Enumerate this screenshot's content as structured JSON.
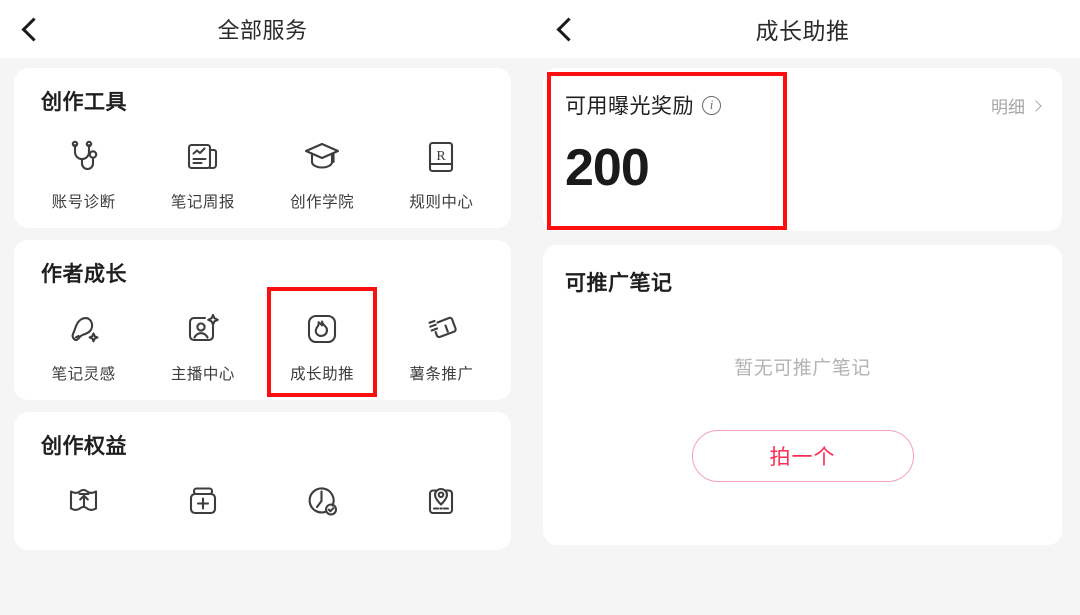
{
  "left_panel": {
    "nav": {
      "title": "全部服务",
      "back_icon": "chevron-left-icon"
    },
    "sections": [
      {
        "title": "创作工具",
        "items": [
          {
            "label": "账号诊断",
            "icon": "stethoscope-icon"
          },
          {
            "label": "笔记周报",
            "icon": "report-chart-icon"
          },
          {
            "label": "创作学院",
            "icon": "graduation-cap-icon"
          },
          {
            "label": "规则中心",
            "icon": "rule-book-r-icon"
          }
        ]
      },
      {
        "title": "作者成长",
        "items": [
          {
            "label": "笔记灵感",
            "icon": "lightbulb-sparkle-icon"
          },
          {
            "label": "主播中心",
            "icon": "person-frame-sparkle-icon"
          },
          {
            "label": "成长助推",
            "icon": "flame-rounded-square-icon",
            "highlighted": true
          },
          {
            "label": "薯条推广",
            "icon": "fries-cards-icon"
          }
        ]
      },
      {
        "title": "创作权益",
        "items": [
          {
            "label": "",
            "icon": "book-upload-icon"
          },
          {
            "label": "",
            "icon": "box-plus-icon"
          },
          {
            "label": "",
            "icon": "clock-check-icon"
          },
          {
            "label": "",
            "icon": "location-card-icon"
          }
        ]
      }
    ]
  },
  "right_panel": {
    "nav": {
      "title": "成长助推",
      "back_icon": "chevron-left-icon"
    },
    "reward_card": {
      "label": "可用曝光奖励",
      "info_icon": "info-circle-icon",
      "value": "200",
      "detail_link": "明细",
      "detail_chevron_icon": "chevron-right-icon",
      "highlighted": true
    },
    "promo_card": {
      "title": "可推广笔记",
      "empty_text": "暂无可推广笔记",
      "button_label": "拍一个"
    }
  },
  "colors": {
    "highlight": "#fb0f0f",
    "accent_pink": "#ff2e55",
    "button_border": "#f4a2b5",
    "page_bg": "#f5f5f5",
    "card_bg": "#ffffff",
    "text_primary": "#1f1f1f",
    "text_muted": "#b3b3b3"
  }
}
